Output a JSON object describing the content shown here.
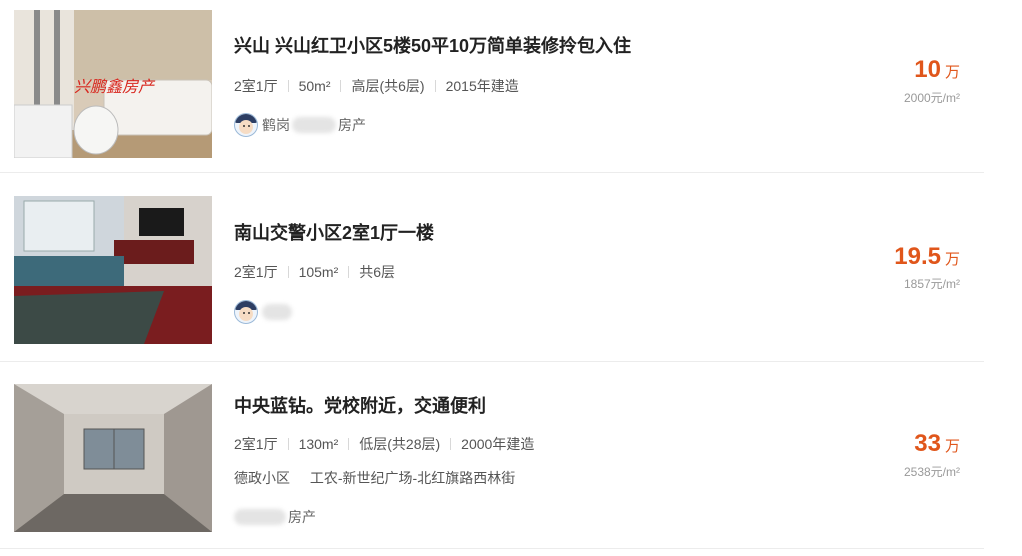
{
  "listings": [
    {
      "title": "兴山 兴山红卫小区5楼50平10万简单装修拎包入住",
      "layout": "2室1厅",
      "area": "50m²",
      "floor": "高层(共6层)",
      "built": "2015年建造",
      "agent_prefix": "鹤岗",
      "agent_suffix": "房产",
      "price": "10",
      "price_unit": "万",
      "unit_price": "2000元/m²",
      "photo_watermark": "兴鹏鑫房产"
    },
    {
      "title": "南山交警小区2室1厅一楼",
      "layout": "2室1厅",
      "area": "105m²",
      "floor": "共6层",
      "price": "19.5",
      "price_unit": "万",
      "unit_price": "1857元/m²"
    },
    {
      "title": "中央蓝钻。党校附近，交通便利",
      "layout": "2室1厅",
      "area": "130m²",
      "floor": "低层(共28层)",
      "built": "2000年建造",
      "community": "德政小区",
      "location": "工农-新世纪广场-北红旗路西林街",
      "agent_suffix": "房产",
      "price": "33",
      "price_unit": "万",
      "unit_price": "2538元/m²"
    }
  ],
  "colors": {
    "price": "#e0561b",
    "divider": "#ececec"
  }
}
